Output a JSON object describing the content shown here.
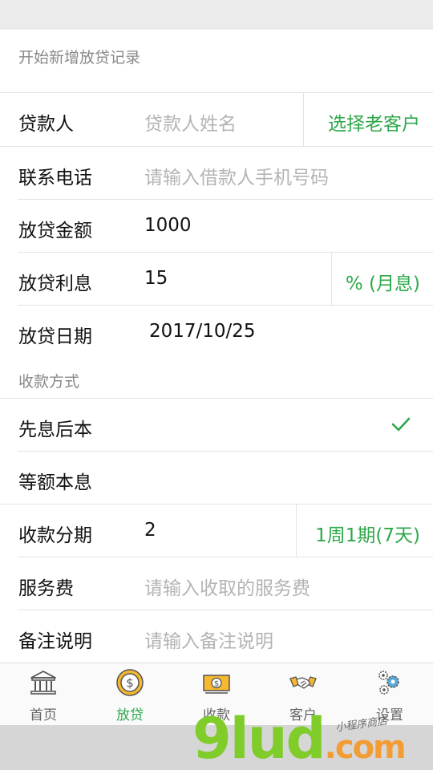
{
  "header": {
    "title": "开始新增放贷记录"
  },
  "form": {
    "borrower": {
      "label": "贷款人",
      "placeholder": "贷款人姓名",
      "action": "选择老客户"
    },
    "phone": {
      "label": "联系电话",
      "placeholder": "请输入借款人手机号码"
    },
    "amount": {
      "label": "放贷金额",
      "value": "1000"
    },
    "interest": {
      "label": "放贷利息",
      "value": "15",
      "unit": "% (月息)"
    },
    "date": {
      "label": "放贷日期",
      "value": "2017/10/25"
    }
  },
  "payment_method": {
    "title": "收款方式",
    "options": [
      {
        "label": "先息后本",
        "selected": true
      },
      {
        "label": "等额本息",
        "selected": false
      }
    ]
  },
  "form2": {
    "installments": {
      "label": "收款分期",
      "value": "2",
      "period": "1周1期(7天)"
    },
    "service_fee": {
      "label": "服务费",
      "placeholder": "请输入收取的服务费"
    },
    "remark": {
      "label": "备注说明",
      "placeholder": "请输入备注说明"
    }
  },
  "tabbar": {
    "tabs": [
      {
        "label": "首页",
        "icon": "bank-icon"
      },
      {
        "label": "放贷",
        "icon": "coin-icon",
        "active": true
      },
      {
        "label": "收款",
        "icon": "cash-icon"
      },
      {
        "label": "客户",
        "icon": "handshake-icon"
      },
      {
        "label": "设置",
        "icon": "gears-icon"
      }
    ]
  },
  "watermark": {
    "brand": "9lud",
    "domain": ".com",
    "tagline": "小程序商店"
  },
  "colors": {
    "accent": "#2ea84a",
    "placeholder": "#b4b4b4",
    "divider": "#e3e3e3"
  }
}
